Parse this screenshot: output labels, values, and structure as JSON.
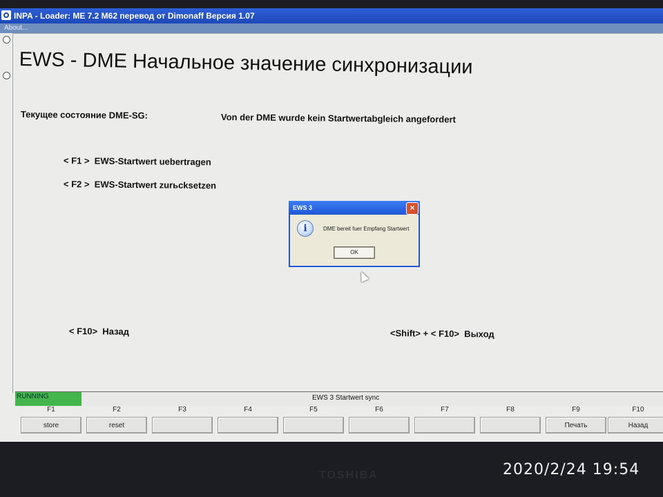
{
  "window": {
    "title": "INPA - Loader:  ME 7.2 M62 перевод от Dimonaff Версия 1.07"
  },
  "menu": {
    "about": "About..."
  },
  "main": {
    "heading": "EWS - DME  Начальное значение синхронизации",
    "state_label": "Текущее состояние DME-SG:",
    "state_value": "Von der DME wurde kein Startwertabgleich angefordert",
    "options": [
      {
        "key": "< F1 >",
        "text": "EWS-Startwert  uebertragen"
      },
      {
        "key": "< F2 >",
        "text": "EWS-Startwert zurьcksetzen"
      }
    ],
    "back_hint": {
      "key": "< F10>",
      "text": "Назад"
    },
    "exit_hint": {
      "key": "<Shift> + < F10>",
      "text": "Выход"
    }
  },
  "dialog": {
    "title": "EWS 3",
    "message": "DME bereit fuer Empfang Startwert",
    "ok_label": "OK",
    "icon": "info-icon"
  },
  "status": {
    "running_label": "RUNNING",
    "running_color": "#44b54a",
    "text": "EWS 3 Startwert sync"
  },
  "fkeys": [
    {
      "label": "F1",
      "button": "store"
    },
    {
      "label": "F2",
      "button": "reset"
    },
    {
      "label": "F3",
      "button": ""
    },
    {
      "label": "F4",
      "button": ""
    },
    {
      "label": "F5",
      "button": ""
    },
    {
      "label": "F6",
      "button": ""
    },
    {
      "label": "F7",
      "button": ""
    },
    {
      "label": "F8",
      "button": ""
    },
    {
      "label": "F9",
      "button": "Печать"
    },
    {
      "label": "F10",
      "button": "Назад"
    }
  ],
  "photo": {
    "timestamp": "2020/2/24  19:54",
    "bezel_brand": "TOSHIBA"
  }
}
